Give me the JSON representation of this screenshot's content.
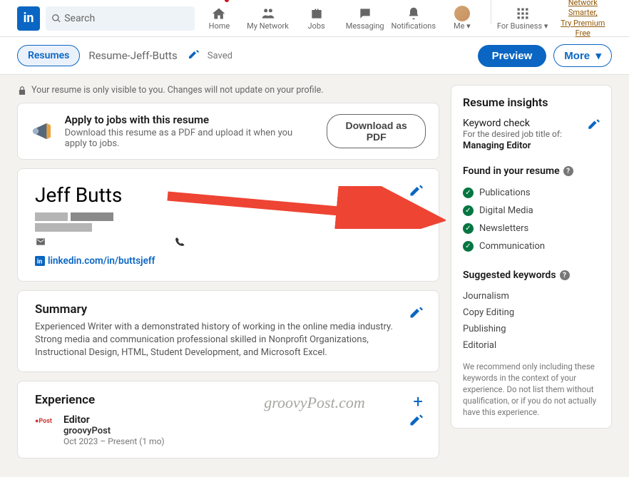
{
  "nav": {
    "search_placeholder": "Search",
    "items": [
      {
        "label": "Home"
      },
      {
        "label": "My Network"
      },
      {
        "label": "Jobs"
      },
      {
        "label": "Messaging"
      },
      {
        "label": "Notifications"
      },
      {
        "label": "Me"
      }
    ],
    "business_label": "For Business",
    "promo_line1": "Network Smarter,",
    "promo_line2": "Try Premium Free"
  },
  "subnav": {
    "resumes_label": "Resumes",
    "resume_name": "Resume-Jeff-Butts",
    "saved_label": "Saved",
    "preview_label": "Preview",
    "more_label": "More"
  },
  "notice": "Your resume is only visible to you. Changes will not update on your profile.",
  "apply_banner": {
    "title": "Apply to jobs with this resume",
    "subtitle": "Download this resume as a PDF and upload it when you apply to jobs.",
    "button": "Download as PDF"
  },
  "profile": {
    "name": "Jeff Butts",
    "linkedin_url": "linkedin.com/in/buttsjeff"
  },
  "summary": {
    "heading": "Summary",
    "text": "Experienced Writer with a demonstrated history of working in the online media industry. Strong media and communication professional skilled in Nonprofit Organizations, Instructional Design, HTML, Student Development, and Microsoft Excel."
  },
  "experience": {
    "heading": "Experience",
    "items": [
      {
        "title": "Editor",
        "company": "groovyPost",
        "dates": "Oct 2023 – Present (1 mo)"
      }
    ]
  },
  "insights": {
    "heading": "Resume insights",
    "keyword_check_label": "Keyword check",
    "desired_prefix": "For the desired job title of:",
    "desired_title": "Managing Editor",
    "found_heading": "Found in your resume",
    "found": [
      "Publications",
      "Digital Media",
      "Newsletters",
      "Communication"
    ],
    "suggested_heading": "Suggested keywords",
    "suggested": [
      "Journalism",
      "Copy Editing",
      "Publishing",
      "Editorial"
    ],
    "note": "We recommend only including these keywords in the context of your experience. Do not list them without qualification, or if you do not actually have this experience."
  },
  "watermark": "groovyPost.com"
}
